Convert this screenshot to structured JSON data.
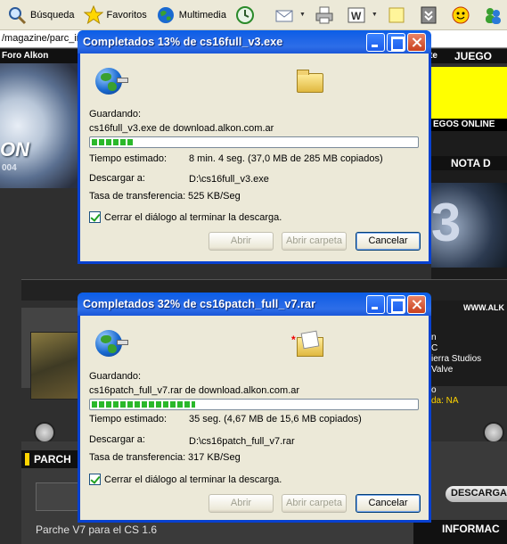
{
  "toolbar": {
    "search_label": "Búsqueda",
    "favorites_label": "Favoritos",
    "media_label": "Multimedia"
  },
  "address": {
    "text": "/magazine/parc_in"
  },
  "site": {
    "topbar_left": "Foro Alkon",
    "topbar_right": "te",
    "juegos": "JUEGO",
    "logo_text": "ON",
    "logo_year": "004",
    "juegos_online": "EGOS ONLINE",
    "nota": "NOTA D",
    "big3": "3",
    "www": "WWW.ALK",
    "side_lines": [
      "n",
      "C",
      "ierra Studios",
      "Valve",
      "o"
    ],
    "side_na": "da: NA",
    "parche": "PARCH",
    "descarga": "DESCARGA",
    "caption": "Parche V7 para el CS 1.6",
    "informac": "INFORMAC"
  },
  "dialogs": [
    {
      "title": "Completados 13% de cs16full_v3.exe",
      "saving_label": "Guardando:",
      "saving_value": "cs16full_v3.exe de download.alkon.com.ar",
      "progress": 0.13,
      "time_label": "Tiempo estimado:",
      "time_value": "8 min. 4 seg. (37,0 MB de 285 MB copiados)",
      "download_label": "Descargar a:",
      "download_value": "D:\\cs16full_v3.exe",
      "rate_label": "Tasa de transferencia:",
      "rate_value": "525 KB/Seg",
      "close_checkbox": "Cerrar el diálogo al terminar la descarga.",
      "open_button": "Abrir",
      "open_folder_button": "Abrir carpeta",
      "cancel_button": "Cancelar"
    },
    {
      "title": "Completados 32% de cs16patch_full_v7.rar",
      "saving_label": "Guardando:",
      "saving_value": "cs16patch_full_v7.rar de download.alkon.com.ar",
      "progress": 0.32,
      "time_label": "Tiempo estimado:",
      "time_value": "35 seg. (4,67 MB de 15,6 MB copiados)",
      "download_label": "Descargar a:",
      "download_value": "D:\\cs16patch_full_v7.rar",
      "rate_label": "Tasa de transferencia:",
      "rate_value": "317 KB/Seg",
      "close_checkbox": "Cerrar el diálogo al terminar la descarga.",
      "open_button": "Abrir",
      "open_folder_button": "Abrir carpeta",
      "cancel_button": "Cancelar"
    }
  ]
}
